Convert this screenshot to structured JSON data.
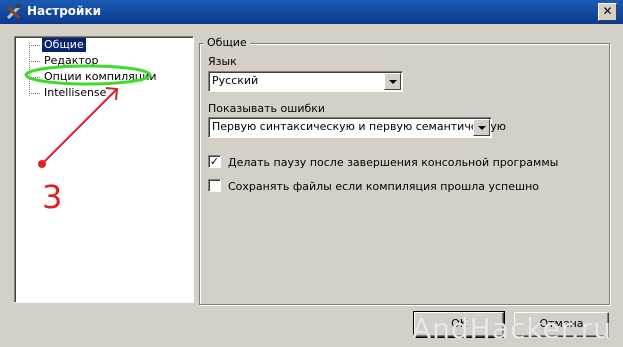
{
  "window": {
    "title": "Настройки",
    "close_glyph": "✕",
    "icon": "tools-icon"
  },
  "tree": {
    "items": [
      {
        "label": "Общие",
        "selected": true
      },
      {
        "label": "Редактор",
        "selected": false
      },
      {
        "label": "Опции компиляции",
        "selected": false
      },
      {
        "label": "Intellisense",
        "selected": false
      }
    ]
  },
  "general": {
    "group_title": "Общие",
    "language_label": "Язык",
    "language_value": "Русский",
    "errors_label": "Показывать ошибки",
    "errors_value": "Первую синтаксическую и первую семантическую",
    "pause_label": "Делать паузу после завершения консольной программы",
    "pause_checked": true,
    "save_label": "Сохранять файлы если компиляция прошла успешно",
    "save_checked": false
  },
  "buttons": {
    "ok": "OK",
    "cancel": "Отмена"
  },
  "annotation": {
    "number": "3",
    "color": "#e02020",
    "highlight_color": "#3ddc2a"
  },
  "watermark": "AndHacker.ru"
}
